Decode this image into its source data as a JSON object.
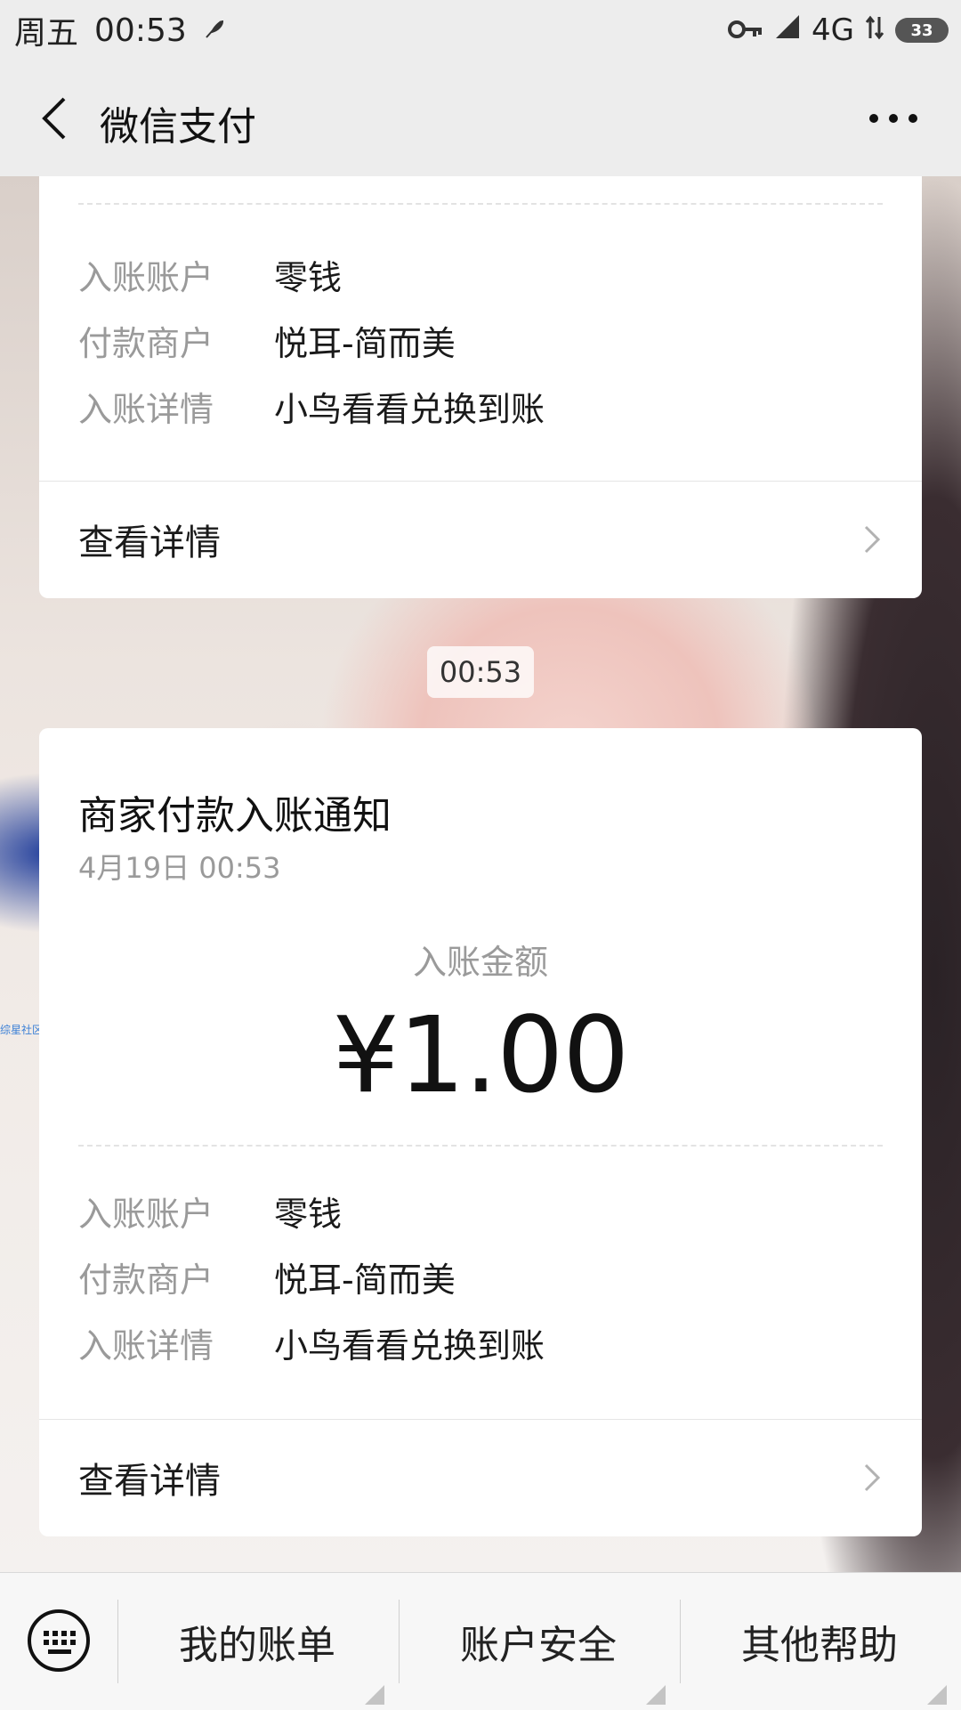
{
  "status_bar": {
    "day": "周五",
    "time": "00:53",
    "network": "4G",
    "battery": "33",
    "icons": [
      "feather-icon",
      "key-icon",
      "signal-icon",
      "data-arrows-icon",
      "battery-icon"
    ]
  },
  "nav": {
    "title": "微信支付",
    "back_icon": "back-arrow-icon",
    "more_icon": "more-dots-icon"
  },
  "card_top": {
    "rows": [
      {
        "label": "入账账户",
        "value": "零钱"
      },
      {
        "label": "付款商户",
        "value": "悦耳-简而美"
      },
      {
        "label": "入账详情",
        "value": "小鸟看看兑换到账"
      }
    ],
    "detail_link": "查看详情"
  },
  "timestamp": "00:53",
  "background_watermark": "综星社区",
  "card_main": {
    "title": "商家付款入账通知",
    "date": "4月19日  00:53",
    "amount_label": "入账金额",
    "amount": "¥1.00",
    "rows": [
      {
        "label": "入账账户",
        "value": "零钱"
      },
      {
        "label": "付款商户",
        "value": "悦耳-简而美"
      },
      {
        "label": "入账详情",
        "value": "小鸟看看兑换到账"
      }
    ],
    "detail_link": "查看详情"
  },
  "bottom_menu": {
    "keyboard_icon": "keyboard-icon",
    "items": [
      "我的账单",
      "账户安全",
      "其他帮助"
    ]
  }
}
